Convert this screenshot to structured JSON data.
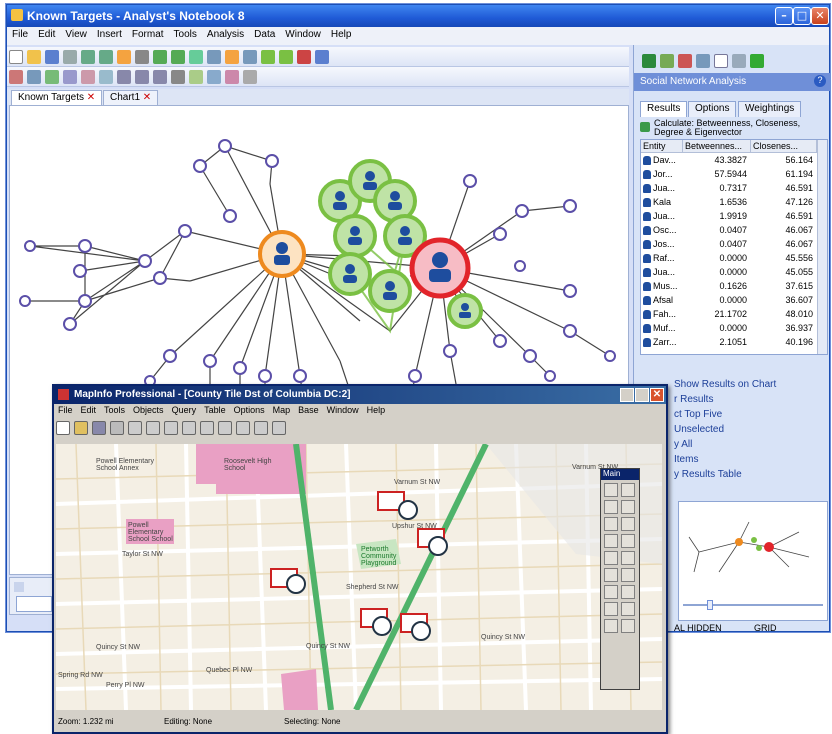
{
  "main_window": {
    "title": "Known Targets - Analyst's Notebook 8",
    "menu": [
      "File",
      "Edit",
      "View",
      "Insert",
      "Format",
      "Tools",
      "Analysis",
      "Data",
      "Window",
      "Help"
    ],
    "tabs": [
      "Known Targets",
      "Chart1"
    ]
  },
  "panel": {
    "title": "Social Network Analysis",
    "tabs": [
      "Results",
      "Options",
      "Weightings"
    ],
    "calculate": "Calculate: Betweenness, Closeness, Degree & Eigenvector",
    "columns": [
      "Entity",
      "Betweennes...",
      "Closenes..."
    ],
    "rows": [
      {
        "entity": "Dav...",
        "betweenness": "43.3827",
        "closeness": "56.164"
      },
      {
        "entity": "Jor...",
        "betweenness": "57.5944",
        "closeness": "61.194"
      },
      {
        "entity": "Jua...",
        "betweenness": "0.7317",
        "closeness": "46.591"
      },
      {
        "entity": "Kala",
        "betweenness": "1.6536",
        "closeness": "47.126"
      },
      {
        "entity": "Jua...",
        "betweenness": "1.9919",
        "closeness": "46.591"
      },
      {
        "entity": "Osc...",
        "betweenness": "0.0407",
        "closeness": "46.067"
      },
      {
        "entity": "Jos...",
        "betweenness": "0.0407",
        "closeness": "46.067"
      },
      {
        "entity": "Raf...",
        "betweenness": "0.0000",
        "closeness": "45.556"
      },
      {
        "entity": "Jua...",
        "betweenness": "0.0000",
        "closeness": "45.055"
      },
      {
        "entity": "Mus...",
        "betweenness": "0.1626",
        "closeness": "37.615"
      },
      {
        "entity": "Afsal",
        "betweenness": "0.0000",
        "closeness": "36.607"
      },
      {
        "entity": "Fah...",
        "betweenness": "21.1702",
        "closeness": "48.010"
      },
      {
        "entity": "Muf...",
        "betweenness": "0.0000",
        "closeness": "36.937"
      },
      {
        "entity": "Zarr...",
        "betweenness": "2.1051",
        "closeness": "40.196"
      }
    ],
    "links": [
      "Show Results on Chart",
      "r Results",
      "ct Top Five",
      "Unselected",
      "y All",
      "Items",
      "y Results Table"
    ],
    "status": [
      "AL HIDDEN",
      "GRID"
    ]
  },
  "map_window": {
    "title": "MapInfo Professional - [County Tile Dst of Columbia DC:2]",
    "menu": [
      "File",
      "Edit",
      "Tools",
      "Objects",
      "Query",
      "Table",
      "Options",
      "Map",
      "Base",
      "Window",
      "Help"
    ],
    "palette_title": "Main",
    "status": {
      "zoom": "Zoom: 1.232 mi",
      "editing": "Editing: None",
      "selecting": "Selecting: None"
    },
    "labels": [
      "Powell Elementary School Annex",
      "Roosevelt High School",
      "Powell Elementary School School",
      "Petworth Community Playground",
      "Varnum St NW",
      "Upshur St NW",
      "Taylor St NW",
      "Shepherd St NW",
      "Quincy St NW",
      "Quincy St NW",
      "Quincy St NW",
      "Quebec Pl NW",
      "Spring Rd NW",
      "Perry Pl NW",
      "Varnum St NW"
    ]
  },
  "colors": {
    "accent": "#1f5ad6",
    "hub_orange": "#ee8a1f",
    "hub_red": "#e2242a",
    "cluster_green": "#7ac043",
    "map_park": "#e9a0c4",
    "map_road": "#4fb36a"
  }
}
